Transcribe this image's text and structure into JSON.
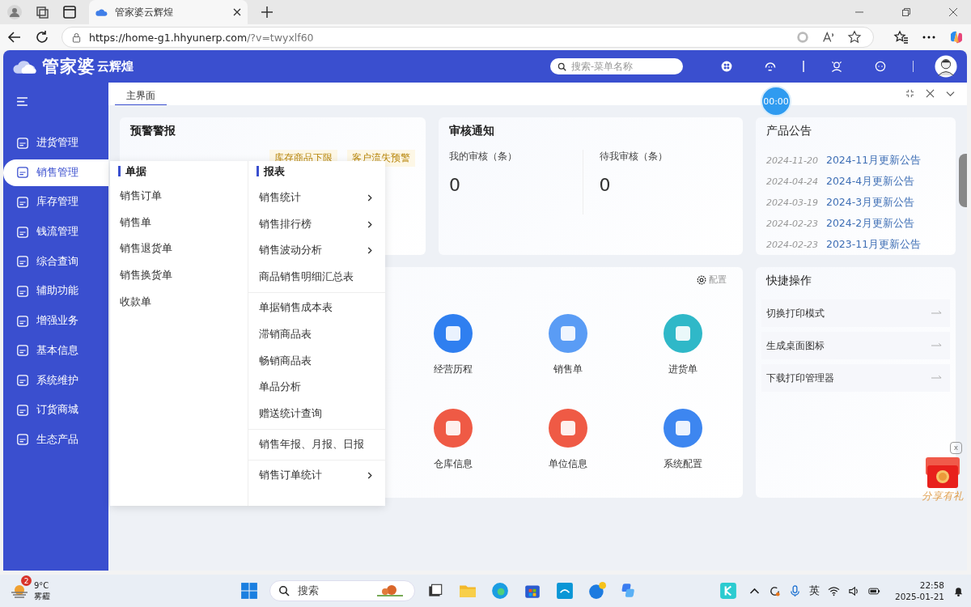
{
  "browser": {
    "tab_title": "管家婆云辉煌",
    "url_host": "https://home-g1.hhyunerp.com",
    "url_rest": "/?v=twyxlf60"
  },
  "header": {
    "logo": "管家婆",
    "logo_sub": "云辉煌",
    "search": {
      "placeholder": "搜索-菜单名称"
    }
  },
  "sidebar": {
    "items": [
      {
        "label": "进货管理",
        "selected": false
      },
      {
        "label": "销售管理",
        "selected": true
      },
      {
        "label": "库存管理",
        "selected": false
      },
      {
        "label": "钱流管理",
        "selected": false
      },
      {
        "label": "综合查询",
        "selected": false
      },
      {
        "label": "辅助功能",
        "selected": false
      },
      {
        "label": "增强业务",
        "selected": false
      },
      {
        "label": "基本信息",
        "selected": false
      },
      {
        "label": "系统维护",
        "selected": false
      },
      {
        "label": "订货商城",
        "selected": false
      },
      {
        "label": "生态产品",
        "selected": false
      }
    ]
  },
  "page_tabs": [
    {
      "label": "主界面",
      "selected": true
    }
  ],
  "timer": "00:00",
  "alerts": {
    "title": "预警警报",
    "tags": [
      "库存商品下限",
      "客户流失预警"
    ]
  },
  "audit": {
    "title": "审核通知",
    "stats": [
      {
        "label": "我的审核（条）",
        "value": "0"
      },
      {
        "label": "待我审核（条）",
        "value": "0"
      }
    ]
  },
  "notices": {
    "title": "产品公告",
    "items": [
      {
        "date": "2024-11-20",
        "title": "2024-11月更新公告"
      },
      {
        "date": "2024-04-24",
        "title": "2024-4月更新公告"
      },
      {
        "date": "2024-03-19",
        "title": "2024-3月更新公告"
      },
      {
        "date": "2024-02-23",
        "title": "2024-2月更新公告"
      },
      {
        "date": "2024-02-23",
        "title": "2023-11月更新公告"
      }
    ]
  },
  "shortcuts": {
    "config": "配置",
    "tiles": [
      {
        "label": "经营历程",
        "color": "#2f7ff0"
      },
      {
        "label": "销售单",
        "color": "#5a9cf5"
      },
      {
        "label": "进货单",
        "color": "#2fb8c8"
      },
      {
        "label": "仓库信息",
        "color": "#ef5a45"
      },
      {
        "label": "单位信息",
        "color": "#ef5a45"
      },
      {
        "label": "系统配置",
        "color": "#3d86f0"
      }
    ]
  },
  "quick": {
    "title": "快捷操作",
    "items": [
      "切换打印模式",
      "生成桌面图标",
      "下载打印管理器"
    ]
  },
  "dropdown": {
    "docs_title": "单据",
    "docs": [
      "销售订单",
      "销售单",
      "销售退货单",
      "销售换货单",
      "收款单"
    ],
    "reports_title": "报表",
    "report_groups": [
      [
        {
          "label": "销售统计",
          "kind": "submenu"
        },
        {
          "label": "销售排行榜",
          "kind": "submenu"
        },
        {
          "label": "销售波动分析",
          "kind": "submenu"
        },
        {
          "label": "商品销售明细汇总表",
          "kind": "link"
        }
      ],
      [
        {
          "label": "单据销售成本表",
          "kind": "link"
        },
        {
          "label": "滞销商品表",
          "kind": "link"
        },
        {
          "label": "畅销商品表",
          "kind": "link"
        },
        {
          "label": "单品分析",
          "kind": "link"
        },
        {
          "label": "赠送统计查询",
          "kind": "link"
        }
      ],
      [
        {
          "label": "销售年报、月报、日报",
          "kind": "link"
        }
      ],
      [
        {
          "label": "销售订单统计",
          "kind": "submenu"
        }
      ]
    ]
  },
  "promo": {
    "label": "分享有礼",
    "close": "x"
  },
  "taskbar": {
    "temp": "9°C",
    "weather": "雾霾",
    "badge": "2",
    "search": "搜索",
    "ime": "英",
    "time": "22:58",
    "date": "2025-01-21"
  }
}
